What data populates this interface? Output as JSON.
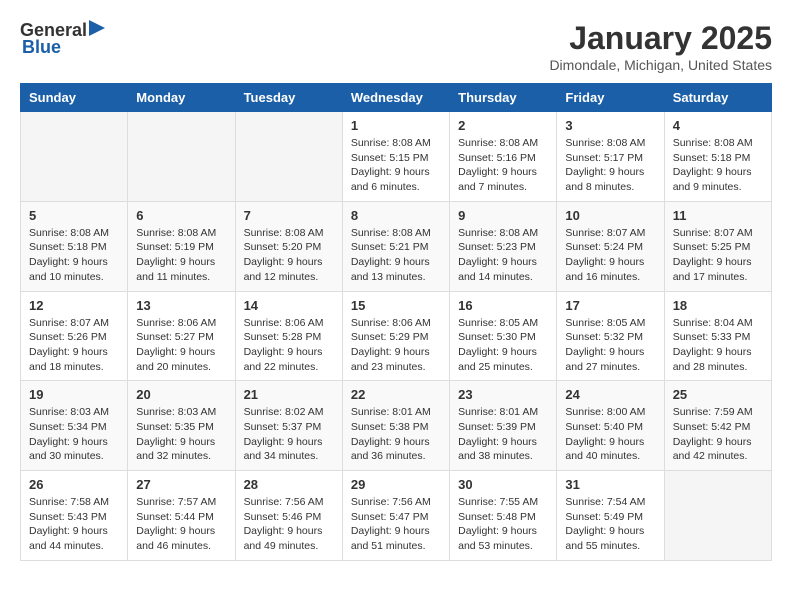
{
  "header": {
    "logo_general": "General",
    "logo_blue": "Blue",
    "month": "January 2025",
    "location": "Dimondale, Michigan, United States"
  },
  "weekdays": [
    "Sunday",
    "Monday",
    "Tuesday",
    "Wednesday",
    "Thursday",
    "Friday",
    "Saturday"
  ],
  "weeks": [
    [
      {
        "day": "",
        "info": ""
      },
      {
        "day": "",
        "info": ""
      },
      {
        "day": "",
        "info": ""
      },
      {
        "day": "1",
        "info": "Sunrise: 8:08 AM\nSunset: 5:15 PM\nDaylight: 9 hours and 6 minutes."
      },
      {
        "day": "2",
        "info": "Sunrise: 8:08 AM\nSunset: 5:16 PM\nDaylight: 9 hours and 7 minutes."
      },
      {
        "day": "3",
        "info": "Sunrise: 8:08 AM\nSunset: 5:17 PM\nDaylight: 9 hours and 8 minutes."
      },
      {
        "day": "4",
        "info": "Sunrise: 8:08 AM\nSunset: 5:18 PM\nDaylight: 9 hours and 9 minutes."
      }
    ],
    [
      {
        "day": "5",
        "info": "Sunrise: 8:08 AM\nSunset: 5:18 PM\nDaylight: 9 hours and 10 minutes."
      },
      {
        "day": "6",
        "info": "Sunrise: 8:08 AM\nSunset: 5:19 PM\nDaylight: 9 hours and 11 minutes."
      },
      {
        "day": "7",
        "info": "Sunrise: 8:08 AM\nSunset: 5:20 PM\nDaylight: 9 hours and 12 minutes."
      },
      {
        "day": "8",
        "info": "Sunrise: 8:08 AM\nSunset: 5:21 PM\nDaylight: 9 hours and 13 minutes."
      },
      {
        "day": "9",
        "info": "Sunrise: 8:08 AM\nSunset: 5:23 PM\nDaylight: 9 hours and 14 minutes."
      },
      {
        "day": "10",
        "info": "Sunrise: 8:07 AM\nSunset: 5:24 PM\nDaylight: 9 hours and 16 minutes."
      },
      {
        "day": "11",
        "info": "Sunrise: 8:07 AM\nSunset: 5:25 PM\nDaylight: 9 hours and 17 minutes."
      }
    ],
    [
      {
        "day": "12",
        "info": "Sunrise: 8:07 AM\nSunset: 5:26 PM\nDaylight: 9 hours and 18 minutes."
      },
      {
        "day": "13",
        "info": "Sunrise: 8:06 AM\nSunset: 5:27 PM\nDaylight: 9 hours and 20 minutes."
      },
      {
        "day": "14",
        "info": "Sunrise: 8:06 AM\nSunset: 5:28 PM\nDaylight: 9 hours and 22 minutes."
      },
      {
        "day": "15",
        "info": "Sunrise: 8:06 AM\nSunset: 5:29 PM\nDaylight: 9 hours and 23 minutes."
      },
      {
        "day": "16",
        "info": "Sunrise: 8:05 AM\nSunset: 5:30 PM\nDaylight: 9 hours and 25 minutes."
      },
      {
        "day": "17",
        "info": "Sunrise: 8:05 AM\nSunset: 5:32 PM\nDaylight: 9 hours and 27 minutes."
      },
      {
        "day": "18",
        "info": "Sunrise: 8:04 AM\nSunset: 5:33 PM\nDaylight: 9 hours and 28 minutes."
      }
    ],
    [
      {
        "day": "19",
        "info": "Sunrise: 8:03 AM\nSunset: 5:34 PM\nDaylight: 9 hours and 30 minutes."
      },
      {
        "day": "20",
        "info": "Sunrise: 8:03 AM\nSunset: 5:35 PM\nDaylight: 9 hours and 32 minutes."
      },
      {
        "day": "21",
        "info": "Sunrise: 8:02 AM\nSunset: 5:37 PM\nDaylight: 9 hours and 34 minutes."
      },
      {
        "day": "22",
        "info": "Sunrise: 8:01 AM\nSunset: 5:38 PM\nDaylight: 9 hours and 36 minutes."
      },
      {
        "day": "23",
        "info": "Sunrise: 8:01 AM\nSunset: 5:39 PM\nDaylight: 9 hours and 38 minutes."
      },
      {
        "day": "24",
        "info": "Sunrise: 8:00 AM\nSunset: 5:40 PM\nDaylight: 9 hours and 40 minutes."
      },
      {
        "day": "25",
        "info": "Sunrise: 7:59 AM\nSunset: 5:42 PM\nDaylight: 9 hours and 42 minutes."
      }
    ],
    [
      {
        "day": "26",
        "info": "Sunrise: 7:58 AM\nSunset: 5:43 PM\nDaylight: 9 hours and 44 minutes."
      },
      {
        "day": "27",
        "info": "Sunrise: 7:57 AM\nSunset: 5:44 PM\nDaylight: 9 hours and 46 minutes."
      },
      {
        "day": "28",
        "info": "Sunrise: 7:56 AM\nSunset: 5:46 PM\nDaylight: 9 hours and 49 minutes."
      },
      {
        "day": "29",
        "info": "Sunrise: 7:56 AM\nSunset: 5:47 PM\nDaylight: 9 hours and 51 minutes."
      },
      {
        "day": "30",
        "info": "Sunrise: 7:55 AM\nSunset: 5:48 PM\nDaylight: 9 hours and 53 minutes."
      },
      {
        "day": "31",
        "info": "Sunrise: 7:54 AM\nSunset: 5:49 PM\nDaylight: 9 hours and 55 minutes."
      },
      {
        "day": "",
        "info": ""
      }
    ]
  ]
}
